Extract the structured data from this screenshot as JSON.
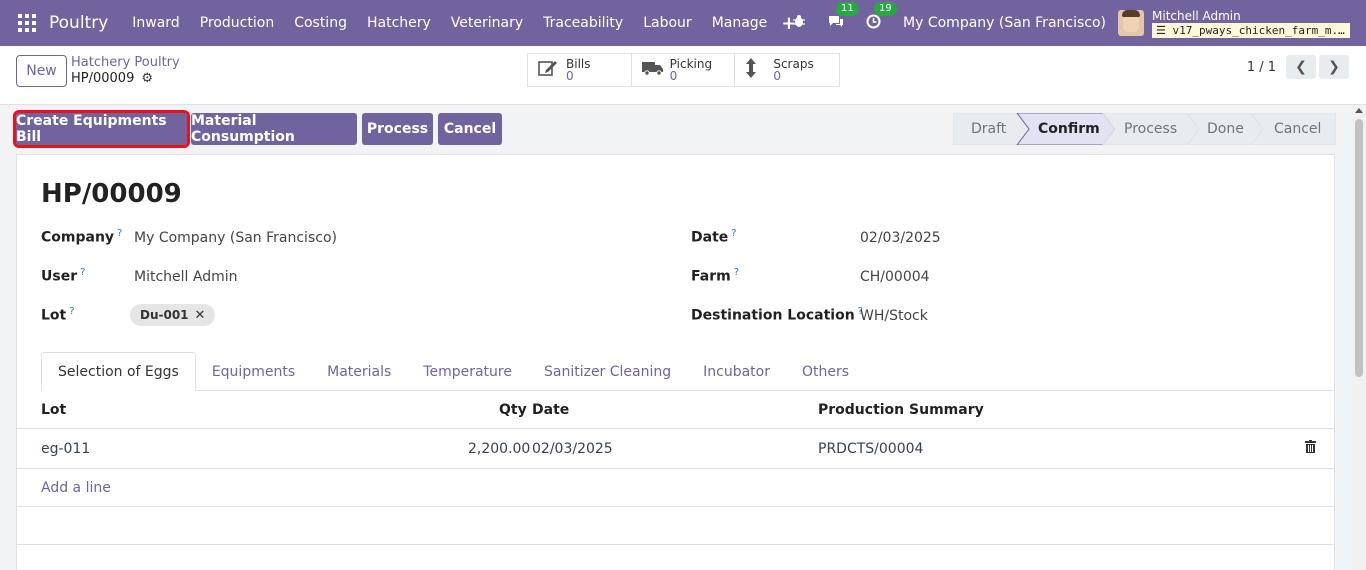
{
  "navbar": {
    "brand": "Poultry",
    "menu": [
      "Inward",
      "Production",
      "Costing",
      "Hatchery",
      "Veterinary",
      "Traceability",
      "Labour",
      "Manage"
    ],
    "plus": "+",
    "messages_badge": "11",
    "activity_badge": "19",
    "company": "My Company (San Francisco)",
    "user_name": "Mitchell Admin",
    "db_name": "v17_pways_chicken_farm_m..."
  },
  "control": {
    "new_label": "New",
    "breadcrumb": "Hatchery Poultry",
    "record": "HP/00009",
    "smart_buttons": [
      {
        "label": "Bills",
        "value": "0",
        "icon": "edit-icon"
      },
      {
        "label": "Picking",
        "value": "0",
        "icon": "truck-icon"
      },
      {
        "label": "Scraps",
        "value": "0",
        "icon": "arrows-vertical-icon"
      }
    ],
    "pager": "1 / 1"
  },
  "statusbar": {
    "actions": [
      "Create Equipments Bill",
      "Material Consumption",
      "Process",
      "Cancel"
    ],
    "stages": [
      "Draft",
      "Confirm",
      "Process",
      "Done",
      "Cancel"
    ],
    "active_stage": "Confirm"
  },
  "form": {
    "title": "HP/00009",
    "company_label": "Company",
    "company_value": "My Company (San Francisco)",
    "user_label": "User",
    "user_value": "Mitchell Admin",
    "lot_label": "Lot",
    "lot_tag": "Du-001",
    "date_label": "Date",
    "date_value": "02/03/2025",
    "farm_label": "Farm",
    "farm_value": "CH/00004",
    "dest_label": "Destination Location",
    "dest_value": "WH/Stock",
    "help": "?"
  },
  "tabs": [
    "Selection of Eggs",
    "Equipments",
    "Materials",
    "Temperature",
    "Sanitizer Cleaning",
    "Incubator",
    "Others"
  ],
  "table": {
    "headers": {
      "lot": "Lot",
      "qty": "Qty",
      "date": "Date",
      "summary": "Production Summary"
    },
    "rows": [
      {
        "lot": "eg-011",
        "qty": "2,200.00",
        "date": "02/03/2025",
        "summary": "PRDCTS/00004"
      }
    ],
    "add_line": "Add a line"
  }
}
